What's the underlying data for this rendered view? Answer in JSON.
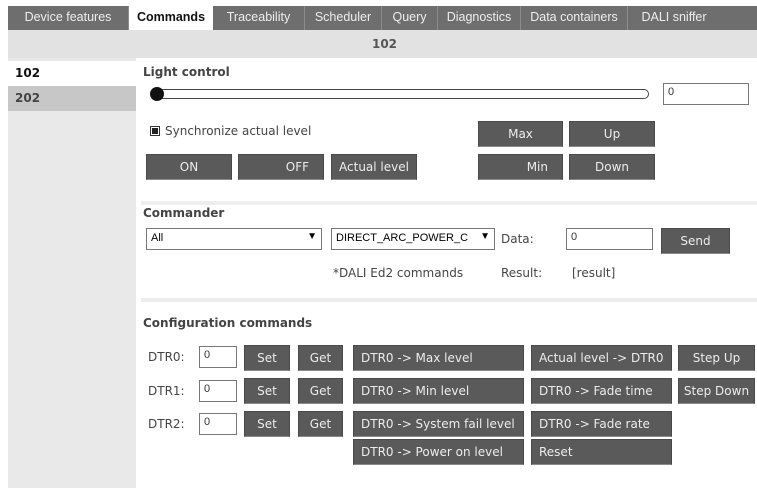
{
  "tabs": [
    "Device features",
    "Commands",
    "Traceability",
    "Scheduler",
    "Query",
    "Diagnostics",
    "Data containers",
    "DALI sniffer"
  ],
  "active_tab": "Commands",
  "device_title": "102",
  "sidebar": {
    "items": [
      {
        "label": "102",
        "selected": true
      },
      {
        "label": "202",
        "selected": false
      }
    ]
  },
  "light_control": {
    "title": "Light control",
    "level_value": "0",
    "slider_level": 0,
    "sync_label": "Synchronize actual level",
    "sync_checked": true,
    "on_label": "ON",
    "off_label": "OFF",
    "actual_level_label": "Actual level",
    "max_label": "Max",
    "up_label": "Up",
    "min_label": "Min",
    "down_label": "Down"
  },
  "commander": {
    "title": "Commander",
    "address_value": "All",
    "command_value": "DIRECT_ARC_POWER_C",
    "data_label": "Data:",
    "data_value": "0",
    "send_label": "Send",
    "note": "*DALI Ed2 commands",
    "result_label": "Result:",
    "result_value": "[result]"
  },
  "config": {
    "title": "Configuration commands",
    "dtr_rows": [
      {
        "label": "DTR0:",
        "value": "0",
        "set": "Set",
        "get": "Get"
      },
      {
        "label": "DTR1:",
        "value": "0",
        "set": "Set",
        "get": "Get"
      },
      {
        "label": "DTR2:",
        "value": "0",
        "set": "Set",
        "get": "Get"
      }
    ],
    "col1": [
      "DTR0 -> Max level",
      "DTR0 -> Min level",
      "DTR0 -> System fail level",
      "DTR0 -> Power on level"
    ],
    "col2": [
      "Actual level -> DTR0",
      "DTR0 -> Fade time",
      "DTR0 -> Fade rate",
      "Reset"
    ],
    "col3": [
      "Step Up",
      "Step Down"
    ]
  },
  "colors": {
    "tab_bar": "#6e6e6e",
    "button": "#5a5a5a",
    "sidebar": "#e9e9e9"
  }
}
